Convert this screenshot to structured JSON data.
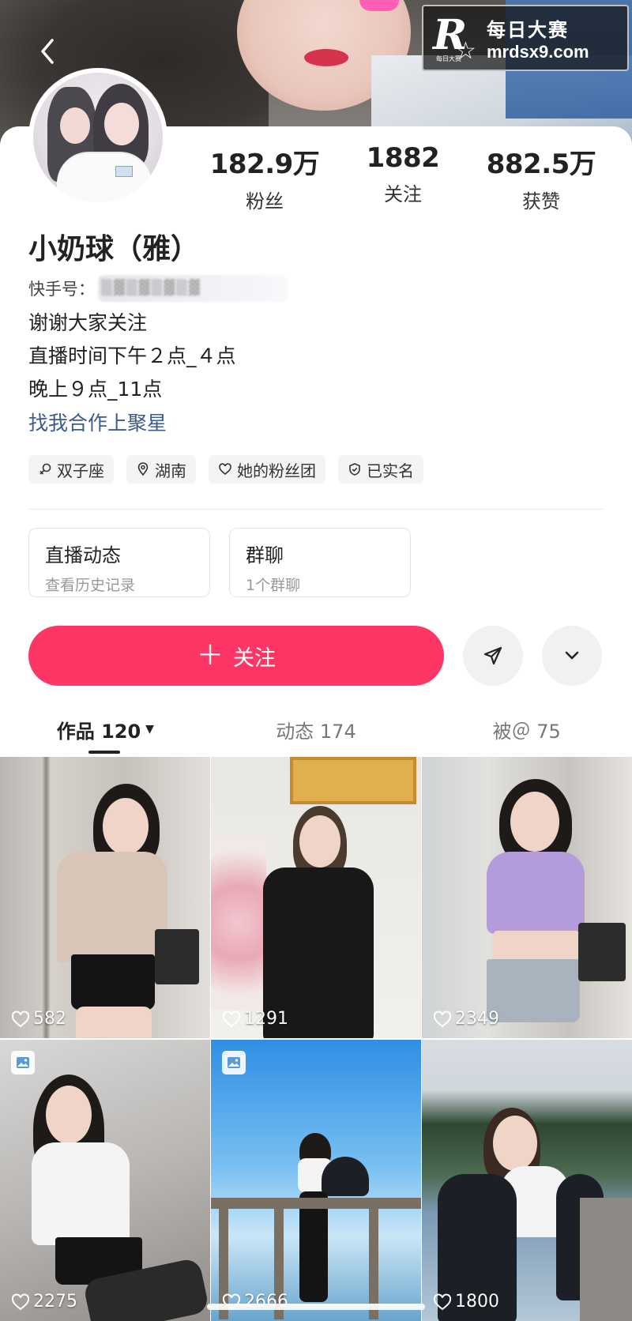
{
  "watermark": {
    "site_cn": "每日大赛",
    "url": "mrdsx9.com",
    "logo_letter": "R",
    "logo_small": "每日大赛"
  },
  "profile": {
    "name": "小奶球（雅）",
    "id_label": "快手号：",
    "stats": [
      {
        "value": "182.9万",
        "label": "粉丝"
      },
      {
        "value": "1882",
        "label": "关注"
      },
      {
        "value": "882.5万",
        "label": "获赞"
      }
    ],
    "bio": [
      "谢谢大家关注",
      "直播时间下午２点_４点",
      "晚上９点_11点"
    ],
    "link": "找我合作上聚星",
    "tags": [
      {
        "icon": "gender-female-icon",
        "label": "双子座"
      },
      {
        "icon": "location-pin-icon",
        "label": "湖南"
      },
      {
        "icon": "heart-outline-icon",
        "label": "她的粉丝团"
      },
      {
        "icon": "shield-check-icon",
        "label": "已实名"
      }
    ]
  },
  "boxes": [
    {
      "title": "直播动态",
      "subtitle": "查看历史记录"
    },
    {
      "title": "群聊",
      "subtitle": "1个群聊"
    }
  ],
  "actions": {
    "follow_label": "关注",
    "follow_icon": "plus-icon",
    "share_icon": "send-icon",
    "more_icon": "chevron-down-icon"
  },
  "tabs": [
    {
      "label": "作品 120",
      "active": true
    },
    {
      "label": "动态 174",
      "active": false
    },
    {
      "label": "被＠ 75",
      "active": false
    }
  ],
  "posts": [
    {
      "likes": "582",
      "image_badge": false
    },
    {
      "likes": "1291",
      "image_badge": false
    },
    {
      "likes": "2349",
      "image_badge": false
    },
    {
      "likes": "2275",
      "image_badge": true
    },
    {
      "likes": "2666",
      "image_badge": true
    },
    {
      "likes": "1800",
      "image_badge": false
    }
  ],
  "colors": {
    "accent": "#fe3666",
    "link": "#3d5a8c"
  }
}
